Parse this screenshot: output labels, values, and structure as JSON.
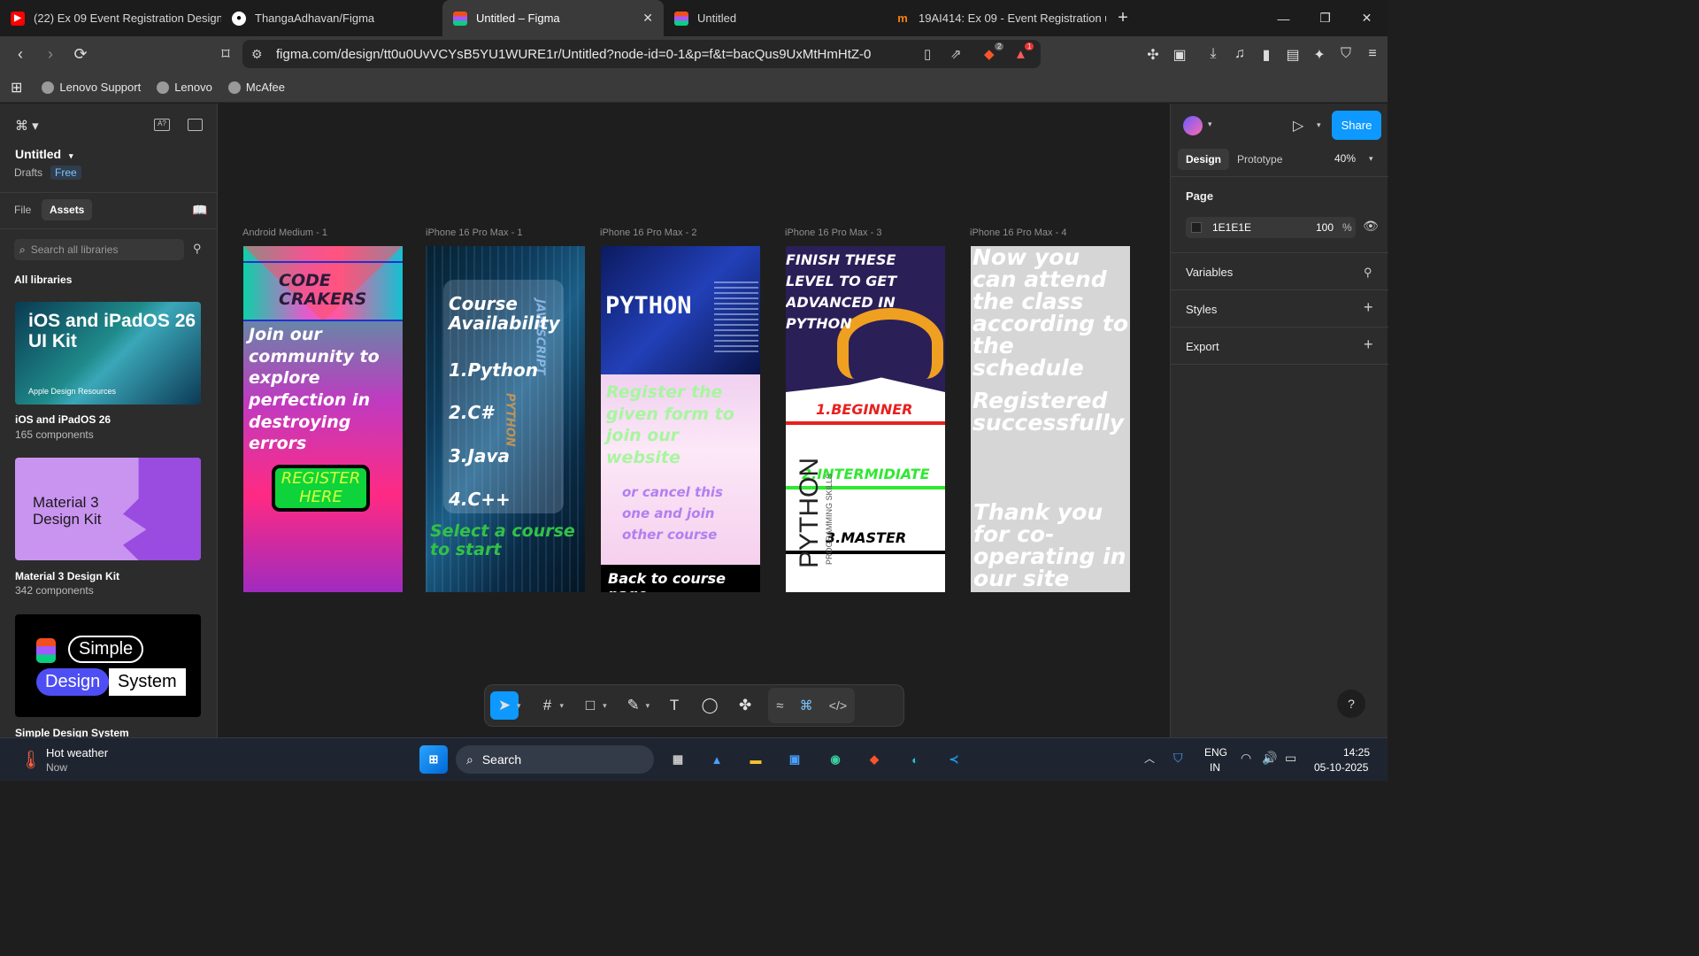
{
  "browser": {
    "tabs": [
      {
        "title": "(22) Ex 09 Event Registration Design c",
        "icon": "youtube-icon",
        "color": "#ff0000"
      },
      {
        "title": "ThangaAdhavan/Figma",
        "icon": "github-icon",
        "color": "#ffffff"
      },
      {
        "title": "Untitled – Figma",
        "icon": "figma-icon",
        "color": "#f24e1e"
      },
      {
        "title": "Untitled",
        "icon": "figma-icon",
        "color": "#f24e1e"
      },
      {
        "title": "19AI414: Ex 09 - Event Registration u",
        "icon": "moodle-icon",
        "color": "#f98012"
      }
    ],
    "url": "figma.com/design/tt0u0UvVCYsB5YU1WURE1r/Untitled?node-id=0-1&p=f&t=bacQus9UxMtHmHtZ-0",
    "brave_badge": "2",
    "alert_badge": "1",
    "bookmarks": [
      "Lenovo Support",
      "Lenovo",
      "McAfee"
    ]
  },
  "figma": {
    "file_name": "Untitled",
    "drafts_label": "Drafts",
    "plan_badge": "Free",
    "left_tabs": {
      "file": "File",
      "assets": "Assets"
    },
    "search_placeholder": "Search all libraries",
    "all_libraries": "All libraries",
    "libraries": [
      {
        "thumb_title": "iOS and iPadOS 26 UI Kit",
        "thumb_sub": "Apple Design Resources",
        "name": "iOS and iPadOS 26",
        "count": "165 components"
      },
      {
        "thumb_title": "Material 3 Design Kit",
        "name": "Material 3 Design Kit",
        "count": "342 components"
      },
      {
        "thumb_words": [
          "Simple",
          "Design",
          "System"
        ],
        "name": "Simple Design System"
      }
    ],
    "right": {
      "share": "Share",
      "tab_design": "Design",
      "tab_prototype": "Prototype",
      "zoom": "40%",
      "page_label": "Page",
      "page_color": "1E1E1E",
      "page_opacity": "100",
      "percent": "%",
      "variables": "Variables",
      "styles": "Styles",
      "export": "Export"
    },
    "frames": [
      {
        "label": "Android Medium - 1",
        "title": "CODE CRAKERS",
        "body": "Join our community to explore perfection in destroying errors",
        "button": "REGISTER HERE"
      },
      {
        "label": "iPhone 16 Pro Max - 1",
        "heading": "Course Availability",
        "courses": [
          "1.Python",
          "2.C#",
          "3.Java",
          "4.C++"
        ],
        "footer": "Select a course to start",
        "bg_text": [
          "JAVASCRIPT",
          "PYTHON",
          "JAVA"
        ]
      },
      {
        "label": "iPhone 16 Pro Max - 2",
        "title": "PYTHON",
        "register": "Register the given form to join our website",
        "cancel": "or cancel this one and join other course",
        "back": "Back to course page"
      },
      {
        "label": "iPhone 16 Pro Max - 3",
        "heading": "FINISH THESE LEVEL TO GET ADVANCED IN PYTHON",
        "levels": [
          "1.BEGINNER",
          "2.INTERMIDIATE",
          "3.MASTER"
        ],
        "side_big": "PYTHON",
        "side_small": "PROGRAMMING SKILLS"
      },
      {
        "label": "iPhone 16 Pro Max - 4",
        "text1": "Now you can attend the class according to the schedule",
        "text2": "Registered successfully",
        "text3": "Thank you for co-operating in our site"
      }
    ]
  },
  "taskbar": {
    "weather_title": "Hot weather",
    "weather_sub": "Now",
    "search": "Search",
    "lang": "ENG",
    "region": "IN",
    "time": "14:25",
    "date": "05-10-2025"
  }
}
